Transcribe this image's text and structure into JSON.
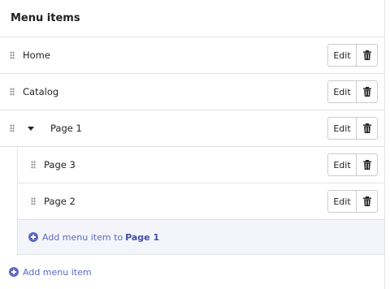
{
  "header": {
    "title": "Menu items"
  },
  "items": [
    {
      "label": "Home",
      "edit_label": "Edit"
    },
    {
      "label": "Catalog",
      "edit_label": "Edit"
    },
    {
      "label": "Page 1",
      "edit_label": "Edit",
      "expanded": true,
      "children": [
        {
          "label": "Page 3",
          "edit_label": "Edit"
        },
        {
          "label": "Page 2",
          "edit_label": "Edit"
        }
      ],
      "add_child": {
        "text": "Add menu item to",
        "target": "Page 1"
      }
    }
  ],
  "add_root_label": "Add menu item",
  "icons": {
    "drag": "drag-handle-icon",
    "caret": "caret-down-icon",
    "delete": "trash-icon",
    "add": "plus-circle-icon"
  },
  "colors": {
    "accent": "#5c6ac4",
    "border": "#e1e3e5",
    "nested_bg": "#f4f5fa"
  }
}
